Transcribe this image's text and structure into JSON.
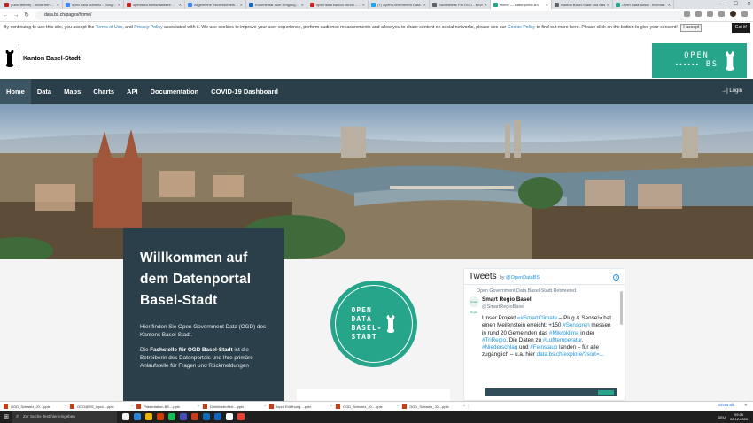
{
  "browser": {
    "tabs": [
      {
        "label": "(Kein Betreff) - jonas.fren…",
        "color": "#c5221f"
      },
      {
        "label": "open data schweiz - Googl…",
        "color": "#4285f4"
      },
      {
        "label": "opendata.swiss/dataset/…",
        "color": "#c5221f"
      },
      {
        "label": "Allgemeine Rechtsschreib…",
        "color": "#4285f4"
      },
      {
        "label": "Kommentar zum Umgang…",
        "color": "#1565c0"
      },
      {
        "label": "open data kanton zürich -…",
        "color": "#c5221f"
      },
      {
        "label": "(7) Open Government Data…",
        "color": "#1da1f2"
      },
      {
        "label": "Sachtabelle FM OGD - Bevöl…",
        "color": "#5f6368"
      },
      {
        "label": "Home — Datenportal BS",
        "color": "#27a58a",
        "active": true
      },
      {
        "label": "Kanton Basel-Stadt und Basel…",
        "color": "#5f6368"
      },
      {
        "label": "Open Data Basel - Inventar…",
        "color": "#27a58a"
      }
    ],
    "window_controls": [
      "—",
      "☐",
      "✕"
    ],
    "url": "data.bs.ch/pages/home/",
    "nav_icons": [
      "←",
      "→",
      "↻"
    ]
  },
  "cookie": {
    "text_a": "By continuing to use this site, you accept the ",
    "terms": "Terms of Use",
    "text_b": ", and ",
    "privacy": "Privacy Policy",
    "text_c": " associated with it. We use cookies to improve your user experience, perform audience measurements and allow you to share content on social networks, please see our ",
    "cookie_policy": "Cookie Policy",
    "text_d": " to find out more here. Please click on the button to give your consent!",
    "accept": "I accept",
    "got_it": "Got it!"
  },
  "header": {
    "kanton_name": "Kanton Basel-Stadt",
    "openbs_line1": "OPEN",
    "openbs_line2": "BS",
    "openbs_dots": "••••••"
  },
  "nav": {
    "items": [
      "Home",
      "Data",
      "Maps",
      "Charts",
      "API",
      "Documentation",
      "COVID-19 Dashboard"
    ],
    "login": "Login",
    "login_icon": "→]"
  },
  "welcome": {
    "title": "Willkommen auf dem Datenportal Basel-Stadt",
    "p1": "Hier finden Sie Open Government Data (OGD) des Kantons Basel-Stadt.",
    "p2_bold": "Fachstelle für OGD Basel-Stadt",
    "p2_pre": "Die ",
    "p2_post": " ist die Betreiberin des Datenportals und Ihre primäre Anlaufstelle für Fragen und Rückmeldungen"
  },
  "circle_logo": {
    "line1": "OPEN",
    "line2": "DATA",
    "line3": "BASEL-",
    "line4": "STADT"
  },
  "tweets": {
    "title": "Tweets",
    "by": "by ",
    "handle": "@OpenDataBS",
    "retweet": "Open Government Data Basel-Stadt Retweeted",
    "author": "Smart Regio Basel",
    "author_handle": "@SmartRegioBasel",
    "avatar_text": "Smart Regio",
    "text_1": "Unser Projekt ",
    "tag_1": "«#SmartClimate",
    "text_2": " – Plug & Sense!» hat einen Meilenstein erreicht: +150 ",
    "tag_2": "#Sensoren",
    "text_3": " messen in rund 20 Gemeinden das ",
    "tag_3": "#Mikroklima",
    "text_4": " in der ",
    "tag_4": "#TriRegio",
    "text_5": ". Die Daten zu ",
    "tag_5": "#Lufttemperatur",
    "text_6": ", ",
    "tag_6": "#Niederschlag",
    "text_7": " und ",
    "tag_7": "#Feinstaub",
    "text_8": " landen – für alle zugänglich – u.a. hier ",
    "tag_8": "data.bs.ch/explore/?sort=..."
  },
  "downloads": {
    "items": [
      "OGD_Schweiz_J0....pptx",
      "OGD@BS_Input....pptx",
      "Präsentation BS....pptx",
      "Direktbetroffen....pptx",
      "Input Eröffnung....pptx",
      "OGD_Schweiz_J0....pptx",
      "OGD_Schweiz_J0....pptx"
    ],
    "show_all": "Show all",
    "close": "✕"
  },
  "taskbar": {
    "start_icon": "⊞",
    "search_placeholder": "Zur Suche Text hier eingeben",
    "app_colors": [
      "#f2f2f2",
      "#2b88d8",
      "#e8b600",
      "#d83b01",
      "#1db954",
      "#464eb8",
      "#c43e1c",
      "#0f6cbd",
      "#1565c0",
      "#ffffff",
      "#ea4335"
    ],
    "tray_lang": "DEU",
    "time": "09:25",
    "date": "08.12.2020"
  }
}
